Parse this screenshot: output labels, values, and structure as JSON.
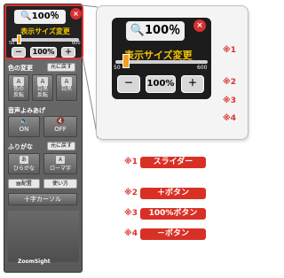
{
  "zoom": {
    "percent": "100％",
    "title": "表示サイズ変更",
    "slider_min": "50",
    "slider_max": "600",
    "minus": "－",
    "reset": "100%",
    "plus": "＋",
    "close": "×"
  },
  "toolbar": {
    "color_section": "色の変更",
    "color_reset": "元に戻す",
    "color_buttons": [
      "色の\n反転",
      "白黒\n反転",
      "白黒"
    ],
    "speech_section": "音声よみあげ",
    "speech_on": "ON",
    "speech_off": "OFF",
    "furigana_section": "ふりがな",
    "furigana_reset": "元に戻す",
    "hiragana": "ひらがな",
    "romaji": "ローマ字",
    "layout": "配置",
    "howto": "使い方",
    "crosshair": "十字カーソル",
    "logo": "ZoomSight"
  },
  "notes": [
    "※1",
    "※2",
    "※3",
    "※4"
  ],
  "legend": [
    {
      "mark": "※1",
      "label": "スライダー"
    },
    {
      "mark": "※2",
      "label": "＋ボタン"
    },
    {
      "mark": "※3",
      "label": "100%ボタン"
    },
    {
      "mark": "※4",
      "label": "－ボタン"
    }
  ],
  "colors": {
    "accent_red": "#d93025",
    "slider_knob": "#f3a020",
    "label_yellow": "#f2c400"
  }
}
